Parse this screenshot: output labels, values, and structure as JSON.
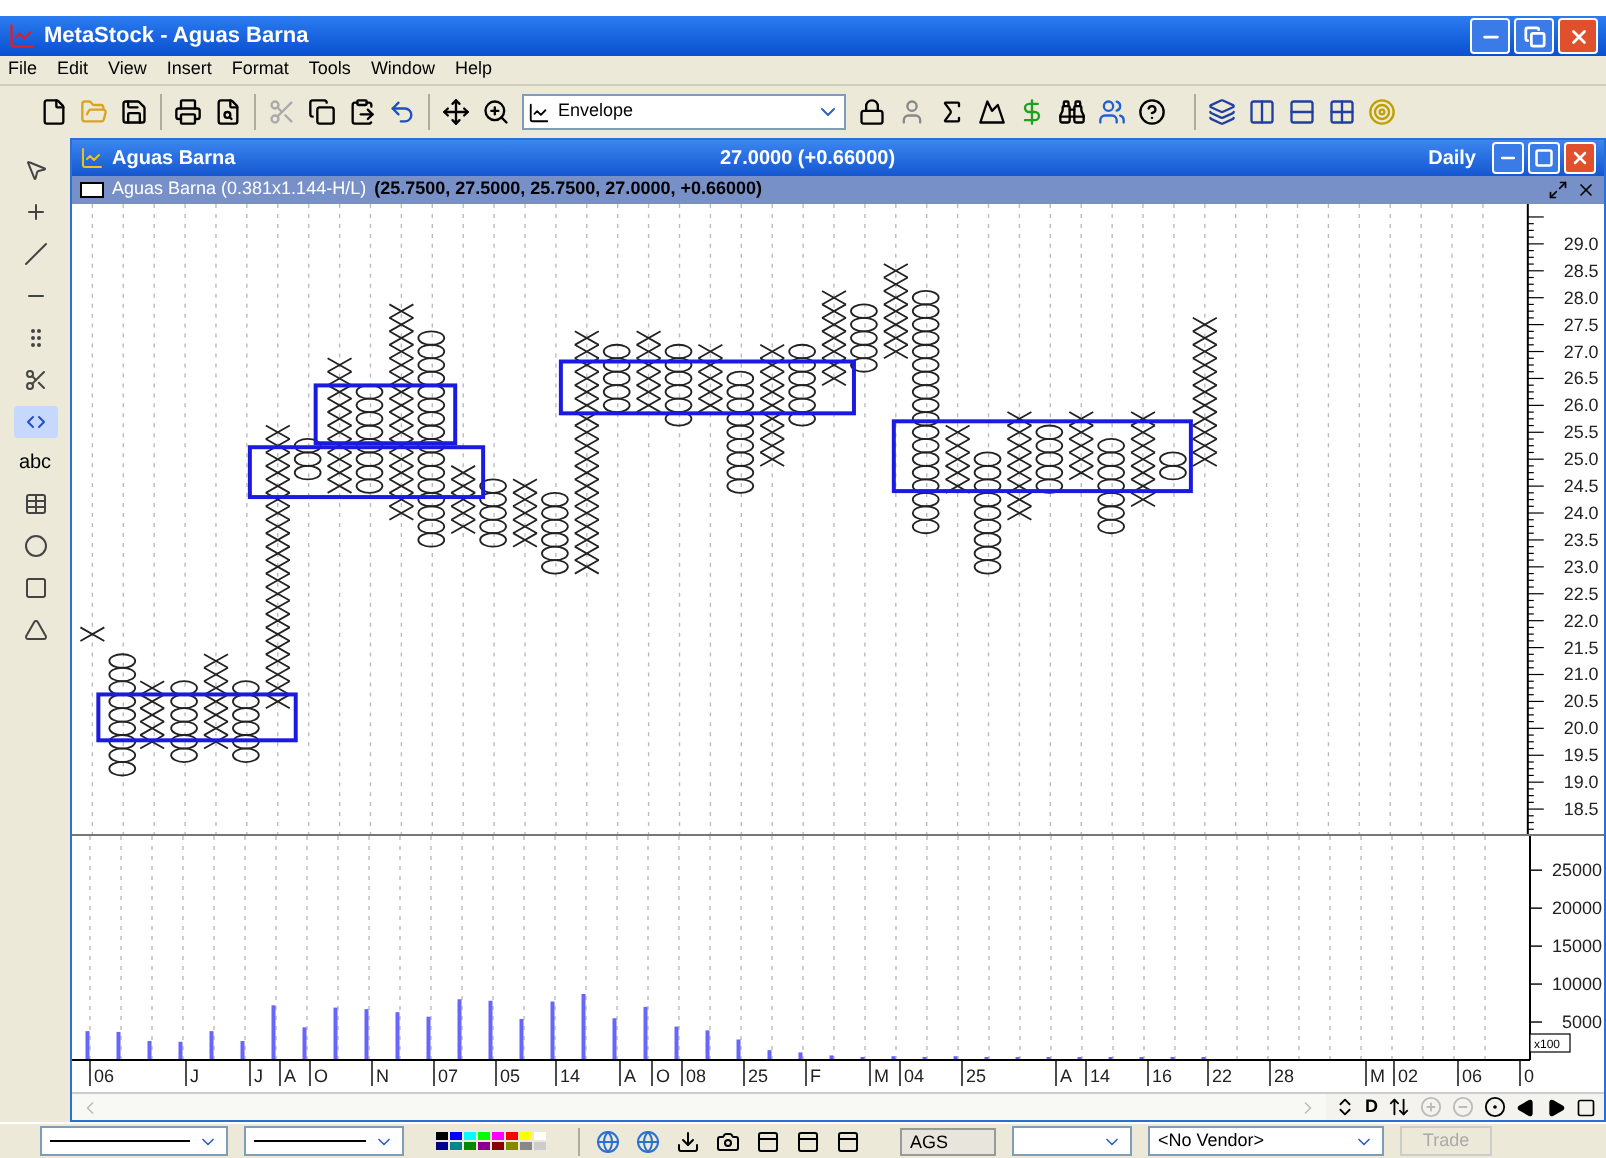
{
  "window": {
    "title": "MetaStock - Aguas Barna"
  },
  "menu": [
    "File",
    "Edit",
    "View",
    "Insert",
    "Format",
    "Tools",
    "Window",
    "Help"
  ],
  "toolbar": {
    "template": "Envelope"
  },
  "left_tools": [
    {
      "selected": false
    },
    {
      "selected": false
    },
    {
      "selected": false
    },
    {
      "selected": false
    },
    {
      "selected": false
    },
    {
      "selected": false
    },
    {
      "selected": true
    },
    {
      "selected": false,
      "label": "abc"
    },
    {
      "selected": false
    },
    {
      "selected": false
    },
    {
      "selected": false
    },
    {
      "selected": false
    }
  ],
  "chart_window": {
    "title": "Aguas Barna",
    "quote": "27.0000 (+0.66000)",
    "period": "Daily"
  },
  "security": {
    "name": "Aguas Barna (0.381x1.144-H/L)",
    "values": "(25.7500, 27.5000, 25.7500, 27.0000, +0.66000)"
  },
  "price_axis": [
    "29.0",
    "28.5",
    "28.0",
    "27.5",
    "27.0",
    "26.5",
    "26.0",
    "25.5",
    "25.0",
    "24.5",
    "24.0",
    "23.5",
    "23.0",
    "22.5",
    "22.0",
    "21.5",
    "21.0",
    "20.5",
    "20.0",
    "19.5",
    "19.0",
    "18.5"
  ],
  "volume": {
    "unit": "x100",
    "chart_data": {
      "type": "bar",
      "grid": true,
      "ylim": [
        0,
        29500
      ],
      "yticks": [
        5000,
        10000,
        15000,
        20000,
        25000
      ],
      "series": [
        {
          "color": "#6666ff",
          "values": [
            3800,
            3700,
            2500,
            2400,
            3800,
            2500,
            7200,
            4300,
            6900,
            6700,
            6300,
            5700,
            8000,
            7800,
            5400,
            7700,
            8700,
            5500,
            7000,
            4400,
            3900,
            2700,
            1300,
            1000,
            600,
            400,
            500,
            400,
            500,
            400,
            400,
            400,
            400,
            400,
            400,
            400,
            400,
            null,
            null,
            null,
            null,
            null,
            null,
            null,
            null,
            null,
            null
          ]
        }
      ]
    }
  },
  "dates": [
    "06",
    "J",
    "J",
    "A",
    "O",
    "N",
    "07",
    "05",
    "14",
    "A",
    "O",
    "08",
    "25",
    "F",
    "M",
    "04",
    "25",
    "A",
    "14",
    "16",
    "22",
    "28",
    "M",
    "02",
    "06",
    "0"
  ],
  "nav": {
    "period": "D"
  },
  "bottom": {
    "symbol": "AGS",
    "vendor": "<No Vendor>",
    "trade": {
      "label": "Trade",
      "disabled": true
    }
  }
}
